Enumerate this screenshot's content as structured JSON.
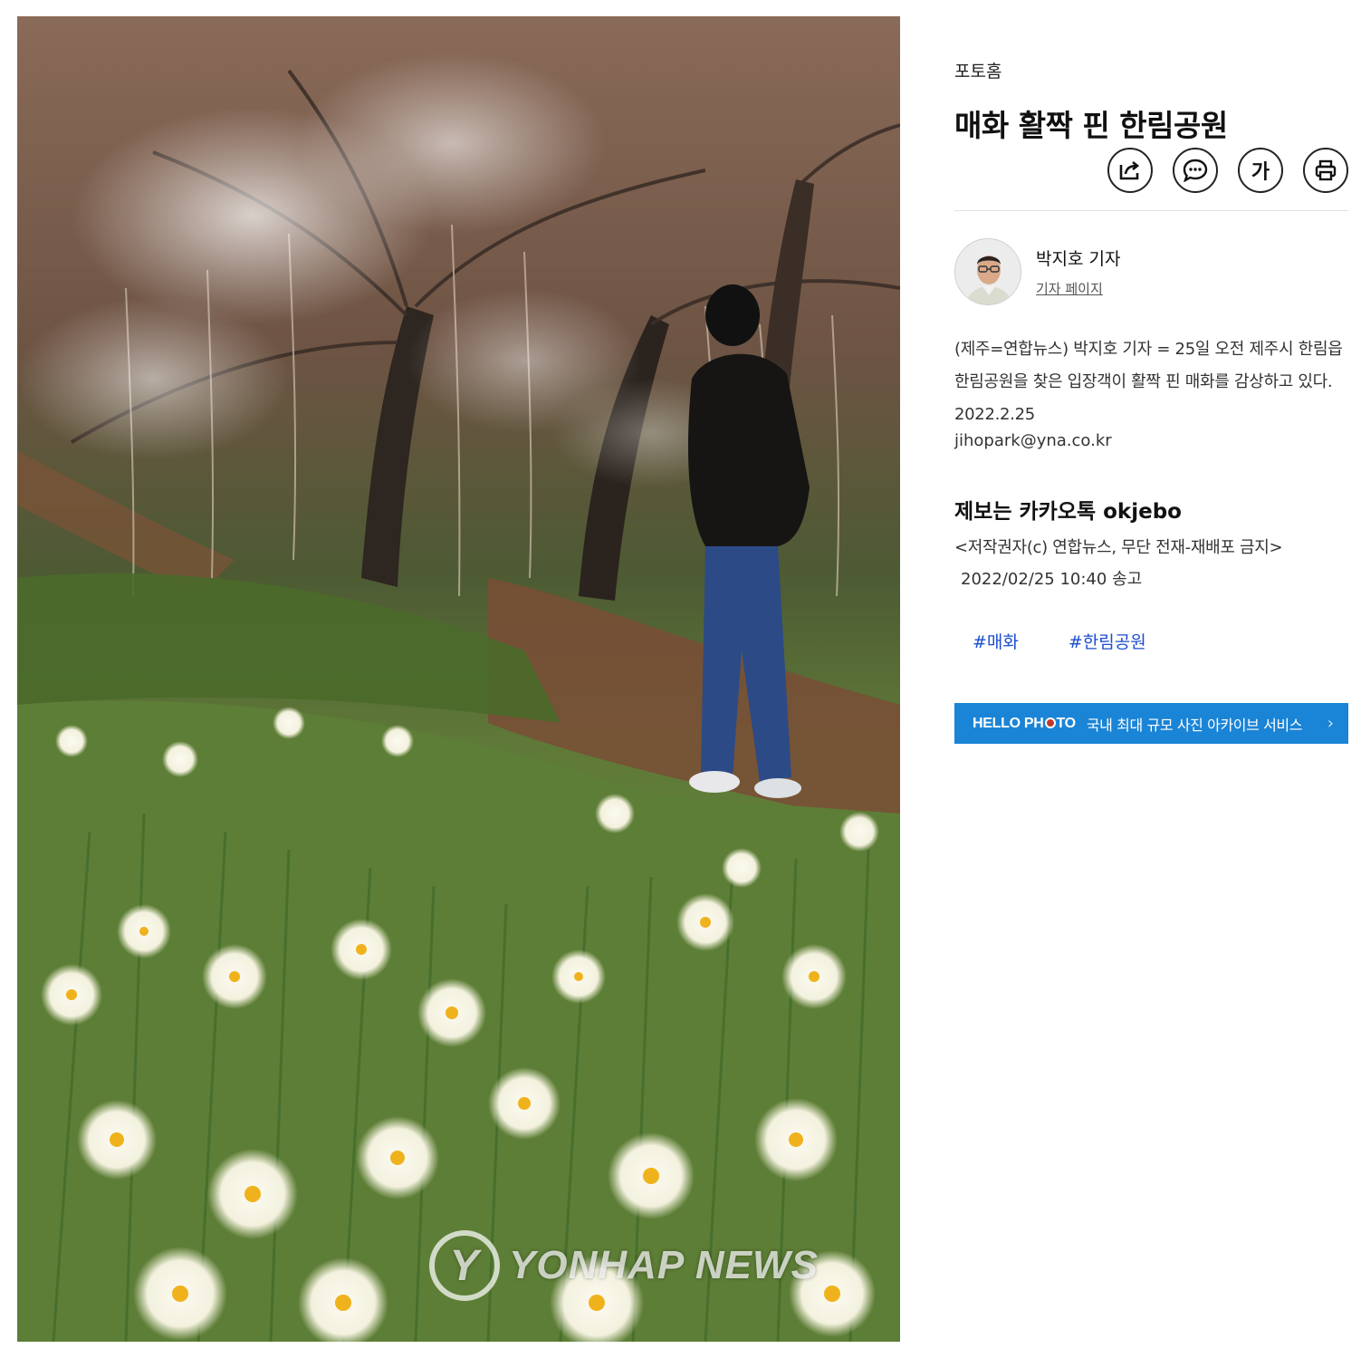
{
  "photo": {
    "alt": "매화 활짝 핀 한림공원",
    "watermark": "YONHAP NEWS",
    "watermark_logo": "Y"
  },
  "article": {
    "section": "포토홈",
    "title": "매화 활짝 핀 한림공원",
    "tools": {
      "share": "share-icon",
      "comment": "comment-icon",
      "font_size_label": "가",
      "print": "print-icon"
    },
    "reporter": {
      "name": "박지호 기자",
      "page_link": "기자 페이지"
    },
    "body": "(제주=연합뉴스) 박지호 기자 = 25일 오전 제주시 한림읍 한림공원을 찾은 입장객이 활짝 핀 매화를 감상하고 있다. 2022.2.25",
    "email": "jihopark@yna.co.kr",
    "tip": "제보는 카카오톡 okjebo",
    "copyright": "<저작권자(c) 연합뉴스, 무단 전재-재배포 금지>",
    "sent": "2022/02/25 10:40 송고",
    "tags": [
      "#매화",
      "#한림공원"
    ]
  },
  "banner": {
    "brand_prefix": "HELLO PH",
    "brand_suffix": "TO",
    "description": "국내 최대 규모 사진 아카이브 서비스",
    "arrow": "›",
    "color": "#1a84d6"
  }
}
